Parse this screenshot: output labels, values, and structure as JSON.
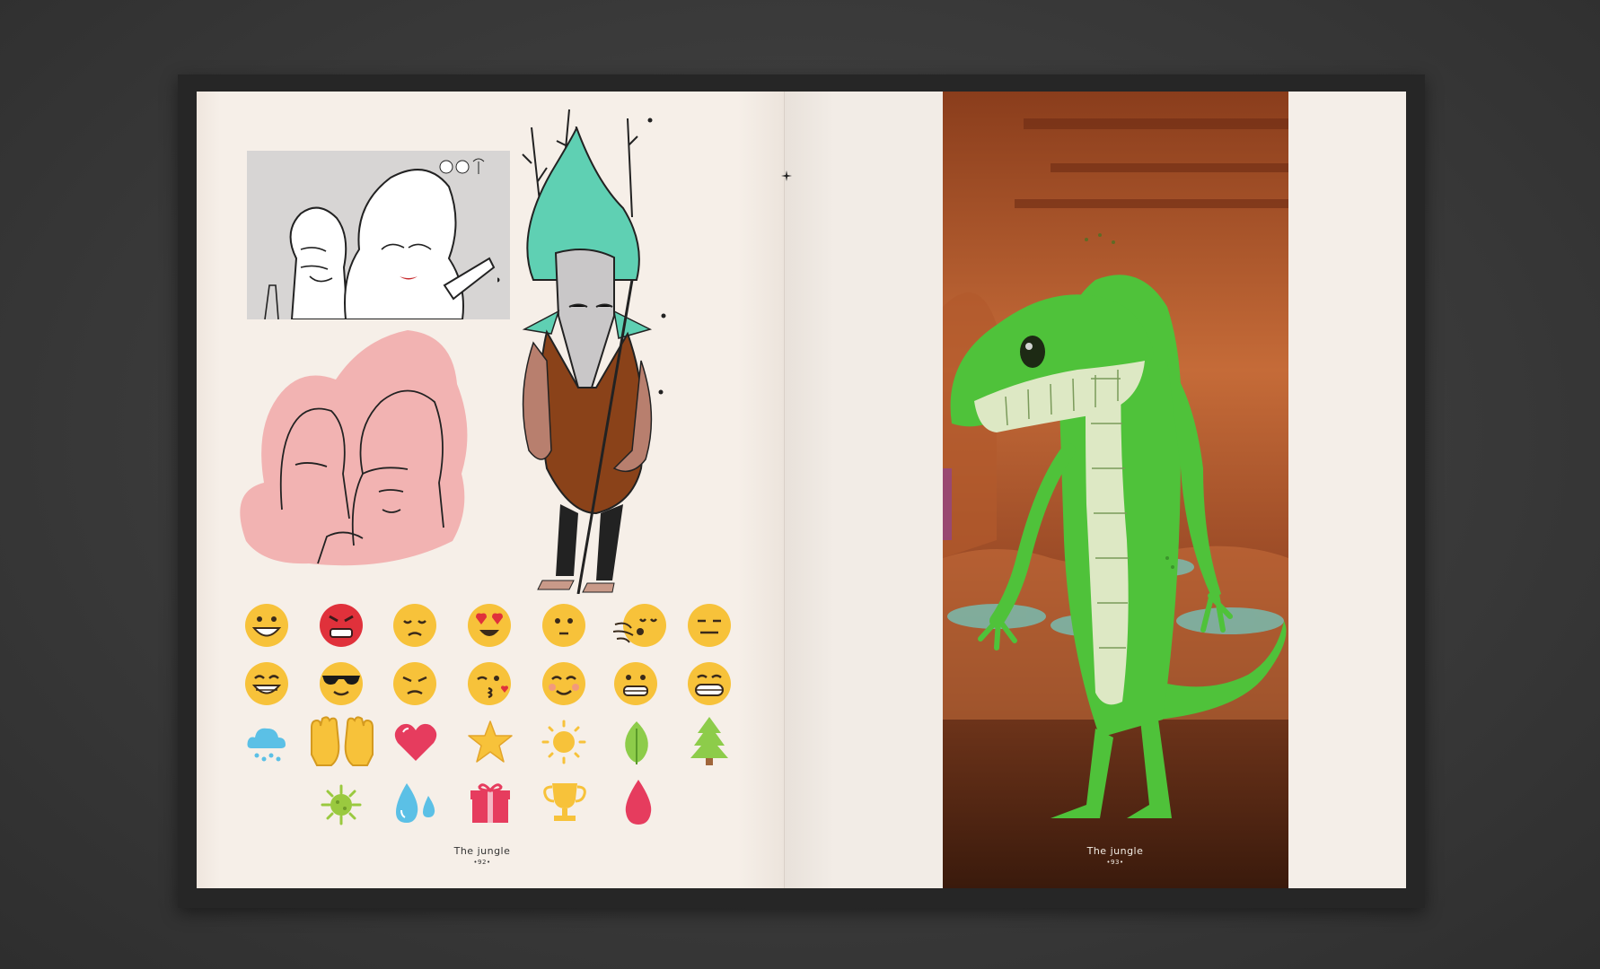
{
  "left_page": {
    "section_title": "The jungle",
    "page_number": "•92•"
  },
  "right_page": {
    "section_title": "The jungle",
    "page_number": "•93•"
  },
  "emoji_grid": [
    "grinning-face",
    "angry-face",
    "disappointed-face",
    "heart-eyes-face",
    "neutral-round-face",
    "blowing-face",
    "expressionless-face",
    "beaming-face",
    "sunglasses-face",
    "pouting-face",
    "kissing-face",
    "blushing-face",
    "grimacing-face",
    "teeth-grin-face",
    "rain-cloud-icon",
    "raised-hands-icon",
    "heart-icon",
    "star-icon",
    "sun-icon",
    "leaf-icon",
    "pine-tree-icon",
    "virus-icon",
    "water-drops-icon",
    "gift-icon",
    "trophy-icon",
    "blood-drop-icon"
  ],
  "colors": {
    "paper": "#f4ede6",
    "emoji_yellow": "#f7c23a",
    "angry_red": "#e0313b",
    "teal_hair": "#5fd0b3",
    "lizard_green": "#4fc23a",
    "background_brown": "#8a3d1c"
  }
}
